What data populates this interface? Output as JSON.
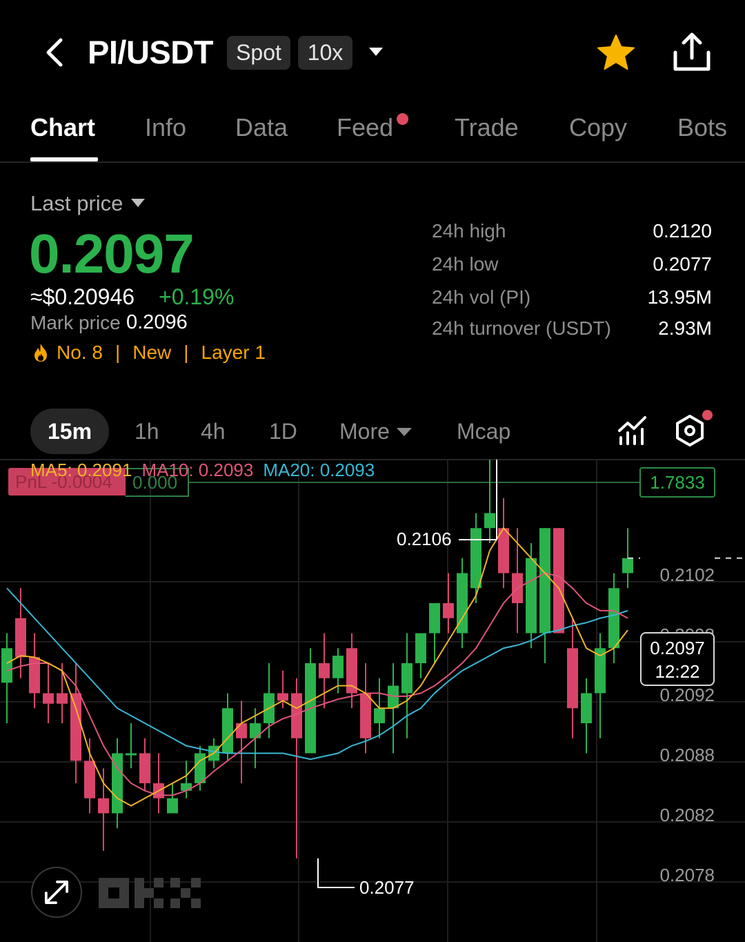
{
  "header": {
    "title": "PI/USDT",
    "market_type": "Spot",
    "leverage": "10x",
    "icons": [
      "back-icon",
      "chevron-down-icon",
      "star-icon",
      "share-icon"
    ]
  },
  "tabs": [
    {
      "label": "Chart",
      "active": true
    },
    {
      "label": "Info"
    },
    {
      "label": "Data"
    },
    {
      "label": "Feed",
      "has_dot": true
    },
    {
      "label": "Trade"
    },
    {
      "label": "Copy"
    },
    {
      "label": "Bots"
    }
  ],
  "price": {
    "label": "Last price",
    "last": "0.2097",
    "usd": "≈$0.20946",
    "change": "+0.19%",
    "mark_label": "Mark price",
    "mark_value": "0.2096",
    "tags": [
      "No. 8",
      "New",
      "Layer 1"
    ]
  },
  "stats": [
    {
      "label": "24h high",
      "value": "0.2120"
    },
    {
      "label": "24h low",
      "value": "0.2077"
    },
    {
      "label": "24h vol (PI)",
      "value": "13.95M"
    },
    {
      "label": "24h turnover (USDT)",
      "value": "2.93M"
    }
  ],
  "timeframes": {
    "active": "15m",
    "items": [
      "1h",
      "4h",
      "1D",
      "More",
      "Mcap"
    ]
  },
  "chart_overlay": {
    "ma5": "MA5: 0.2091",
    "ma10": "MA10: 0.2093",
    "ma20": "MA20: 0.2093",
    "pnl": "PnL -0.0004",
    "pnl_qty": "0.000",
    "position": "1.7833",
    "current_price": "0.2097",
    "countdown": "12:22",
    "high_label": "0.2106",
    "low_label": "0.2077"
  },
  "colors": {
    "up": "#2bb24c",
    "down": "#d9456a",
    "ma5": "#f0b429",
    "ma10": "#e0557a",
    "ma20": "#38b7d4",
    "accent": "#f7a600"
  },
  "chart_data": {
    "type": "candlestick",
    "y_ticks": [
      "0.2102",
      "0.2098",
      "0.2092",
      "0.2088",
      "0.2082",
      "0.2078"
    ],
    "ylim": [
      0.2076,
      0.2108
    ],
    "candles": [
      {
        "o": 0.20887,
        "h": 0.2092,
        "l": 0.2086,
        "c": 0.2091
      },
      {
        "o": 0.2093,
        "h": 0.2095,
        "l": 0.2089,
        "c": 0.20904
      },
      {
        "o": 0.20904,
        "h": 0.2092,
        "l": 0.2087,
        "c": 0.2088
      },
      {
        "o": 0.2088,
        "h": 0.209,
        "l": 0.2086,
        "c": 0.20873
      },
      {
        "o": 0.2088,
        "h": 0.209,
        "l": 0.2086,
        "c": 0.20873
      },
      {
        "o": 0.2088,
        "h": 0.209,
        "l": 0.2082,
        "c": 0.20835
      },
      {
        "o": 0.20835,
        "h": 0.2085,
        "l": 0.208,
        "c": 0.2081
      },
      {
        "o": 0.2081,
        "h": 0.2083,
        "l": 0.20775,
        "c": 0.208
      },
      {
        "o": 0.208,
        "h": 0.2085,
        "l": 0.2079,
        "c": 0.2084
      },
      {
        "o": 0.2084,
        "h": 0.2086,
        "l": 0.2083,
        "c": 0.2084
      },
      {
        "o": 0.2084,
        "h": 0.2085,
        "l": 0.20815,
        "c": 0.2082
      },
      {
        "o": 0.2082,
        "h": 0.2084,
        "l": 0.208,
        "c": 0.2081
      },
      {
        "o": 0.208,
        "h": 0.2082,
        "l": 0.208,
        "c": 0.2081
      },
      {
        "o": 0.20815,
        "h": 0.20835,
        "l": 0.2081,
        "c": 0.2082
      },
      {
        "o": 0.2082,
        "h": 0.20845,
        "l": 0.20815,
        "c": 0.2084
      },
      {
        "o": 0.20835,
        "h": 0.2085,
        "l": 0.2083,
        "c": 0.20845
      },
      {
        "o": 0.2084,
        "h": 0.2088,
        "l": 0.20835,
        "c": 0.2087
      },
      {
        "o": 0.2086,
        "h": 0.20875,
        "l": 0.2082,
        "c": 0.2085
      },
      {
        "o": 0.2085,
        "h": 0.2087,
        "l": 0.2083,
        "c": 0.2086
      },
      {
        "o": 0.2086,
        "h": 0.209,
        "l": 0.2085,
        "c": 0.2088
      },
      {
        "o": 0.2088,
        "h": 0.20895,
        "l": 0.2087,
        "c": 0.20875
      },
      {
        "o": 0.2088,
        "h": 0.2089,
        "l": 0.2077,
        "c": 0.2085
      },
      {
        "o": 0.2084,
        "h": 0.2091,
        "l": 0.2084,
        "c": 0.209
      },
      {
        "o": 0.209,
        "h": 0.2092,
        "l": 0.2087,
        "c": 0.2089
      },
      {
        "o": 0.2089,
        "h": 0.2091,
        "l": 0.2088,
        "c": 0.20905
      },
      {
        "o": 0.2091,
        "h": 0.2092,
        "l": 0.2087,
        "c": 0.2088
      },
      {
        "o": 0.2088,
        "h": 0.209,
        "l": 0.2084,
        "c": 0.2085
      },
      {
        "o": 0.2086,
        "h": 0.2089,
        "l": 0.2085,
        "c": 0.2087
      },
      {
        "o": 0.2087,
        "h": 0.209,
        "l": 0.2084,
        "c": 0.20885
      },
      {
        "o": 0.2088,
        "h": 0.2092,
        "l": 0.2085,
        "c": 0.209
      },
      {
        "o": 0.209,
        "h": 0.2092,
        "l": 0.2089,
        "c": 0.2092
      },
      {
        "o": 0.2092,
        "h": 0.2094,
        "l": 0.209,
        "c": 0.2094
      },
      {
        "o": 0.2094,
        "h": 0.2096,
        "l": 0.2092,
        "c": 0.2093
      },
      {
        "o": 0.2092,
        "h": 0.2097,
        "l": 0.2091,
        "c": 0.2096
      },
      {
        "o": 0.2095,
        "h": 0.21,
        "l": 0.2094,
        "c": 0.2099
      },
      {
        "o": 0.2099,
        "h": 0.2106,
        "l": 0.2098,
        "c": 0.21
      },
      {
        "o": 0.2099,
        "h": 0.2101,
        "l": 0.2095,
        "c": 0.2096
      },
      {
        "o": 0.2096,
        "h": 0.2099,
        "l": 0.2092,
        "c": 0.2094
      },
      {
        "o": 0.2092,
        "h": 0.2098,
        "l": 0.2091,
        "c": 0.2097
      },
      {
        "o": 0.2092,
        "h": 0.2099,
        "l": 0.209,
        "c": 0.2099
      },
      {
        "o": 0.2099,
        "h": 0.2099,
        "l": 0.2093,
        "c": 0.2092
      },
      {
        "o": 0.2091,
        "h": 0.2093,
        "l": 0.2085,
        "c": 0.2087
      },
      {
        "o": 0.2086,
        "h": 0.2089,
        "l": 0.2084,
        "c": 0.2088
      },
      {
        "o": 0.2088,
        "h": 0.2092,
        "l": 0.2085,
        "c": 0.2091
      },
      {
        "o": 0.2091,
        "h": 0.2096,
        "l": 0.209,
        "c": 0.2095
      },
      {
        "o": 0.2096,
        "h": 0.2099,
        "l": 0.2095,
        "c": 0.2097
      }
    ],
    "ma5": [
      0.209,
      0.20905,
      0.20904,
      0.209,
      0.20895,
      0.2087,
      0.2084,
      0.2082,
      0.2081,
      0.20805,
      0.2081,
      0.20815,
      0.2082,
      0.20825,
      0.20835,
      0.2084,
      0.2085,
      0.2086,
      0.20865,
      0.2087,
      0.20875,
      0.2087,
      0.20875,
      0.2088,
      0.20885,
      0.20885,
      0.2088,
      0.2087,
      0.2087,
      0.20875,
      0.20885,
      0.209,
      0.20915,
      0.2093,
      0.20945,
      0.20975,
      0.2099,
      0.2098,
      0.2097,
      0.2096,
      0.2095,
      0.2093,
      0.2091,
      0.20905,
      0.2091,
      0.20922
    ],
    "ma10": [
      0.20895,
      0.20898,
      0.209,
      0.209,
      0.20895,
      0.20885,
      0.20865,
      0.20845,
      0.2083,
      0.2082,
      0.20815,
      0.20812,
      0.20812,
      0.20815,
      0.2082,
      0.20828,
      0.20835,
      0.20842,
      0.2085,
      0.20858,
      0.20863,
      0.20866,
      0.2087,
      0.20873,
      0.20876,
      0.20878,
      0.2088,
      0.2088,
      0.20878,
      0.20878,
      0.2088,
      0.20885,
      0.20892,
      0.209,
      0.2091,
      0.20925,
      0.2094,
      0.2095,
      0.20955,
      0.2096,
      0.20958,
      0.2095,
      0.2094,
      0.20935,
      0.20935,
      0.2093
    ],
    "ma20": [
      0.2095,
      0.2094,
      0.2093,
      0.2092,
      0.2091,
      0.209,
      0.2089,
      0.2088,
      0.2087,
      0.20865,
      0.2086,
      0.20855,
      0.2085,
      0.20845,
      0.20843,
      0.20841,
      0.2084,
      0.2084,
      0.2084,
      0.2084,
      0.2084,
      0.20838,
      0.20836,
      0.20838,
      0.2084,
      0.20845,
      0.20848,
      0.20852,
      0.20858,
      0.20865,
      0.2087,
      0.2088,
      0.20888,
      0.20895,
      0.209,
      0.20905,
      0.2091,
      0.20912,
      0.20915,
      0.2092,
      0.20922,
      0.20925,
      0.20927,
      0.2093,
      0.20932,
      0.20935
    ]
  }
}
